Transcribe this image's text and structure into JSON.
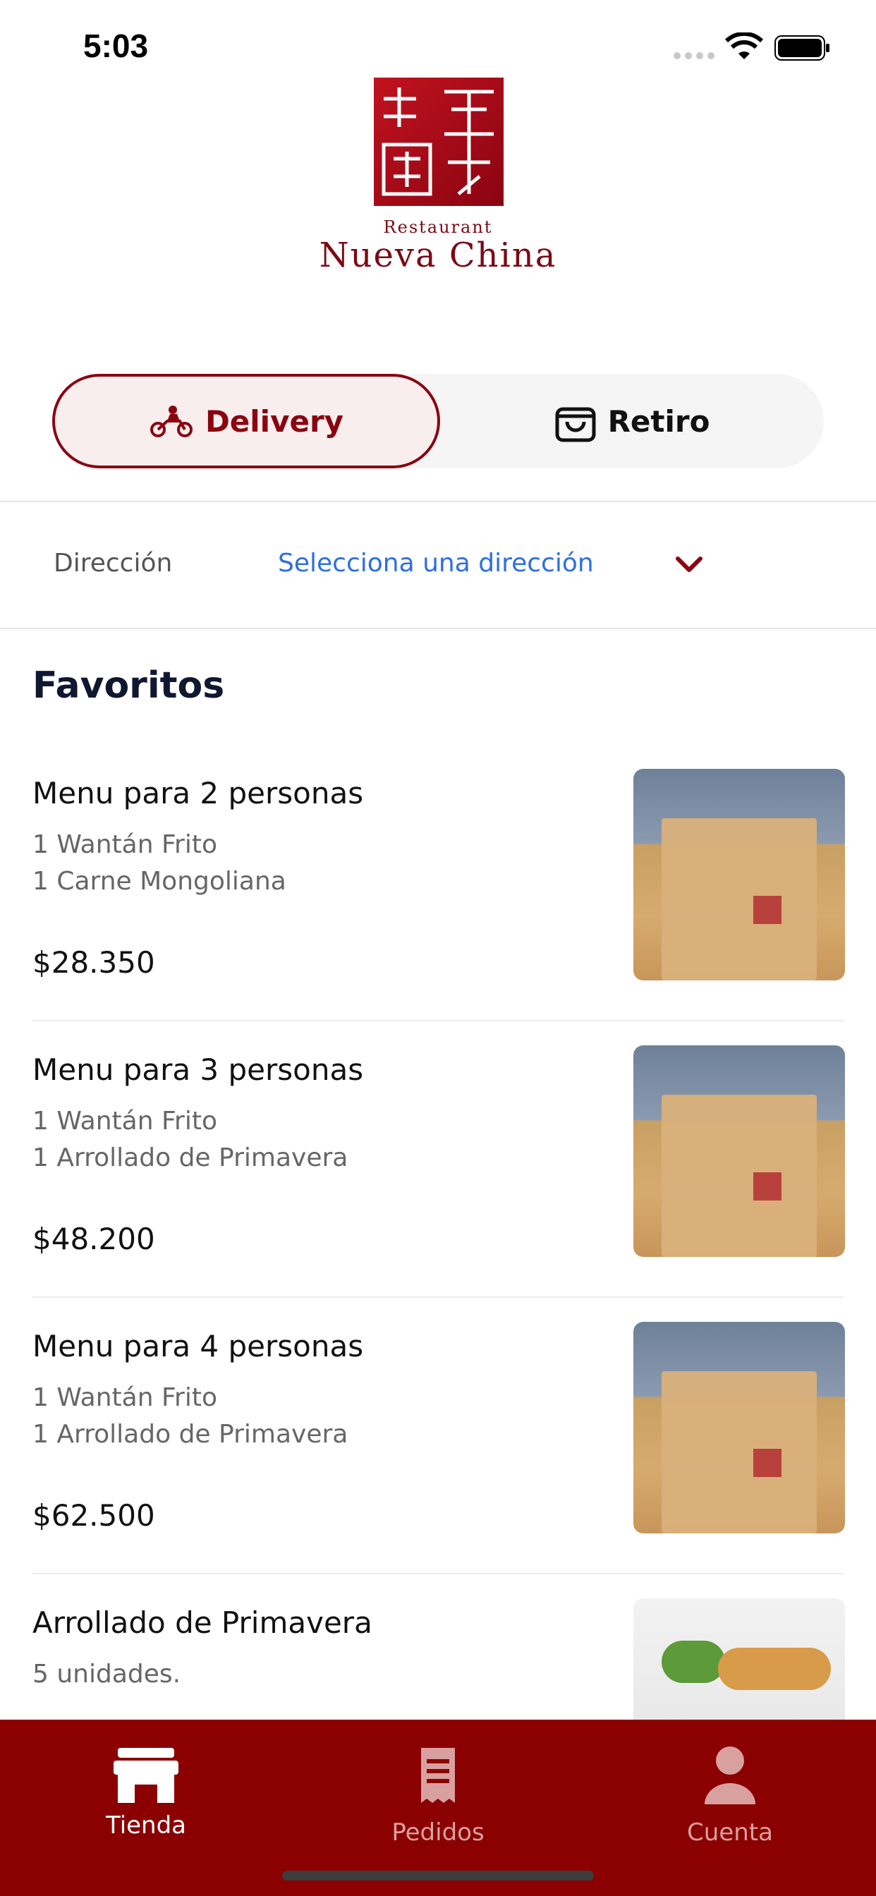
{
  "status_bar": {
    "time": "5:03"
  },
  "logo": {
    "small_text": "Restaurant",
    "big_text": "Nueva China"
  },
  "segment": {
    "delivery_label": "Delivery",
    "retiro_label": "Retiro"
  },
  "address": {
    "label": "Dirección",
    "value": "Selecciona una dirección"
  },
  "section_title": "Favoritos",
  "products": [
    {
      "name": "Menu para 2 personas",
      "desc1": "1 Wantán Frito",
      "desc2": "1 Carne Mongoliana",
      "price": "$28.350",
      "image": "takeout-bag-photo"
    },
    {
      "name": "Menu para 3 personas",
      "desc1": "1 Wantán Frito",
      "desc2": "1 Arrollado de Primavera",
      "price": "$48.200",
      "image": "takeout-bag-photo"
    },
    {
      "name": "Menu para 4 personas",
      "desc1": "1 Wantán Frito",
      "desc2": "1 Arrollado de Primavera",
      "price": "$62.500",
      "image": "takeout-bag-photo"
    },
    {
      "name": "Arrollado de Primavera",
      "desc1": "5 unidades.",
      "desc2": "",
      "price": "",
      "image": "spring-roll-photo"
    }
  ],
  "tabbar": {
    "tabs": [
      {
        "label": "Tienda",
        "icon": "store-icon",
        "active": true
      },
      {
        "label": "Pedidos",
        "icon": "receipt-icon",
        "active": false
      },
      {
        "label": "Cuenta",
        "icon": "person-icon",
        "active": false
      }
    ]
  },
  "colors": {
    "brand": "#8b0000",
    "link": "#2e6fe0",
    "title": "#101730"
  }
}
